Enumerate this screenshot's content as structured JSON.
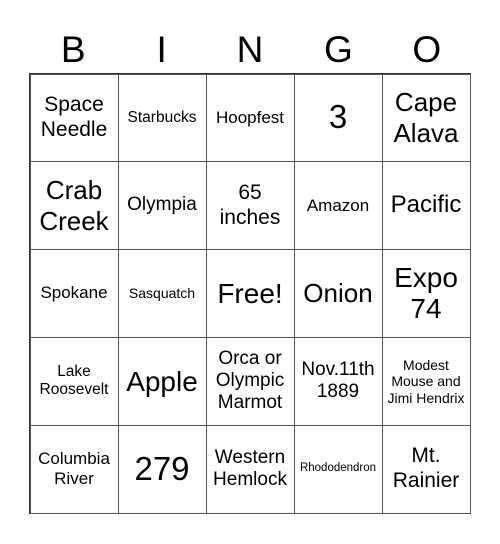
{
  "header": {
    "letters": [
      "B",
      "I",
      "N",
      "G",
      "O"
    ]
  },
  "rows": [
    [
      "Space Needle",
      "Starbucks",
      "Hoopfest",
      "3",
      "Cape Alava"
    ],
    [
      "Crab Creek",
      "Olympia",
      "65 inches",
      "Amazon",
      "Pacific"
    ],
    [
      "Spokane",
      "Sasquatch",
      "Free!",
      "Onion",
      "Expo 74"
    ],
    [
      "Lake Roosevelt",
      "Apple",
      "Orca or Olympic Marmot",
      "Nov.11th 1889",
      "Modest Mouse and Jimi Hendrix"
    ],
    [
      "Columbia River",
      "279",
      "Western Hemlock",
      "Rhododendron",
      "Mt. Rainier"
    ]
  ]
}
